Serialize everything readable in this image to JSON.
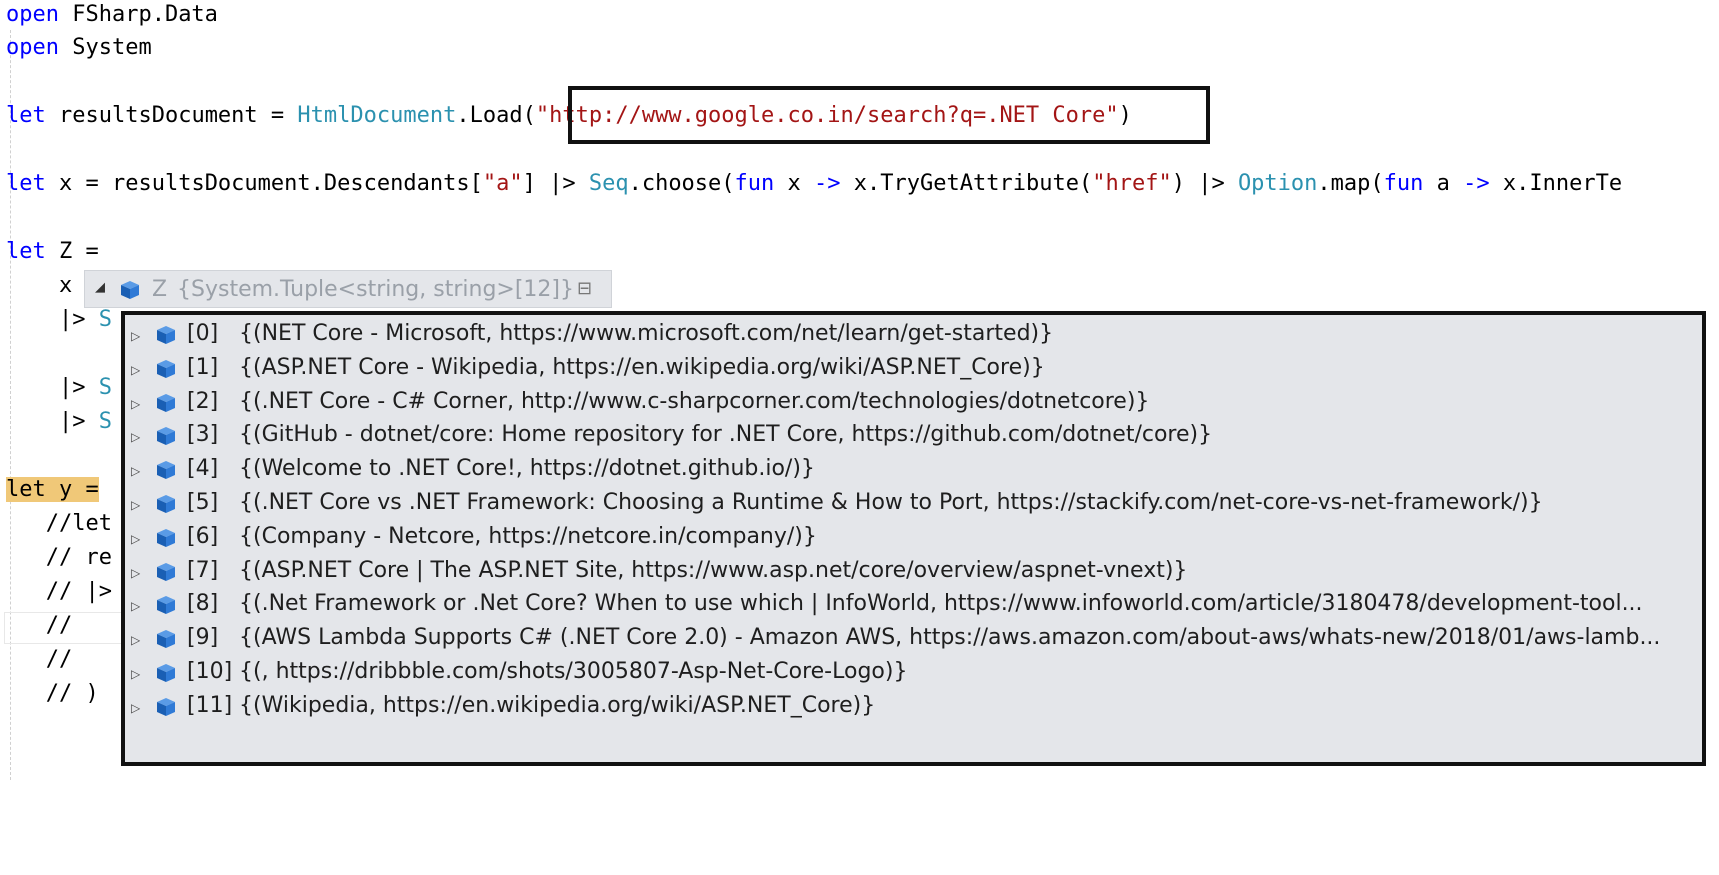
{
  "editor": {
    "lines": {
      "l1_kw": "open",
      "l1_rest": " FSharp.Data",
      "l2_kw": "open",
      "l2_rest": " System",
      "l3_kw": "let",
      "l3_a": " resultsDocument = ",
      "l3_type": "HtmlDocument",
      "l3_b": ".Load(",
      "l3_str": "\"http://www.google.co.in/search?q=.NET Core\"",
      "l3_c": ")",
      "l4_kw": "let",
      "l4_a": " x = resultsDocument.Descendants[",
      "l4_str1": "\"a\"",
      "l4_b": "] |> ",
      "l4_seq": "Seq",
      "l4_c": ".choose(",
      "l4_fun": "fun",
      "l4_d": " x ",
      "l4_arrow1": "->",
      "l4_e": " x.TryGetAttribute(",
      "l4_str2": "\"href\"",
      "l4_f": ") |> ",
      "l4_opt": "Option",
      "l4_g": ".map(",
      "l4_fun2": "fun",
      "l4_h": " a ",
      "l4_arrow2": "->",
      "l4_i": " x.InnerTe",
      "l5_kw": "let",
      "l5_rest": " Z =",
      "l6": "    x",
      "l7_a": "    |> ",
      "l7_s": "S",
      "l8_a": "    |> ",
      "l8_s": "S",
      "l9_a": "    |> ",
      "l9_s": "S",
      "l10": "let y =",
      "l11": "   //let",
      "l12": "   // re",
      "l13": "   // |>",
      "l14": "   //",
      "l15": "   //",
      "l16": "   // )"
    }
  },
  "datatip": {
    "name": "Z",
    "type": "{System.Tuple<string, string>[12]}",
    "expand_glyph": "◢",
    "pin_glyph": "⊟",
    "icons": {
      "row_expander": "triangle-right-icon",
      "field": "blue-cube-icon",
      "pin": "pin-icon"
    },
    "items": [
      {
        "index": "[0]",
        "value": "{(NET Core - Microsoft, https://www.microsoft.com/net/learn/get-started)}"
      },
      {
        "index": "[1]",
        "value": "{(ASP.NET Core - Wikipedia, https://en.wikipedia.org/wiki/ASP.NET_Core)}"
      },
      {
        "index": "[2]",
        "value": "{(.NET Core - C# Corner, http://www.c-sharpcorner.com/technologies/dotnetcore)}"
      },
      {
        "index": "[3]",
        "value": "{(GitHub - dotnet/core: Home repository for .NET Core, https://github.com/dotnet/core)}"
      },
      {
        "index": "[4]",
        "value": "{(Welcome to .NET Core!, https://dotnet.github.io/)}"
      },
      {
        "index": "[5]",
        "value": "{(.NET Core vs .NET Framework: Choosing a Runtime & How to Port, https://stackify.com/net-core-vs-net-framework/)}"
      },
      {
        "index": "[6]",
        "value": "{(Company - Netcore, https://netcore.in/company/)}"
      },
      {
        "index": "[7]",
        "value": "{(ASP.NET Core | The ASP.NET Site, https://www.asp.net/core/overview/aspnet-vnext)}"
      },
      {
        "index": "[8]",
        "value": "{(.Net Framework or .Net Core? When to use which | InfoWorld, https://www.infoworld.com/article/3180478/development-tool..."
      },
      {
        "index": "[9]",
        "value": "{(AWS Lambda Supports C# (.NET Core 2.0) - Amazon AWS, https://aws.amazon.com/about-aws/whats-new/2018/01/aws-lamb..."
      },
      {
        "index": "[10]",
        "value": "{(, https://dribbble.com/shots/3005807-Asp-Net-Core-Logo)}"
      },
      {
        "index": "[11]",
        "value": "{(Wikipedia, https://en.wikipedia.org/wiki/ASP.NET_Core)}"
      }
    ]
  },
  "colors": {
    "keyword": "#0000ff",
    "type": "#2b91af",
    "string": "#a31515",
    "highlight": "#f0c878",
    "tip_bg": "#e4e6ea"
  }
}
